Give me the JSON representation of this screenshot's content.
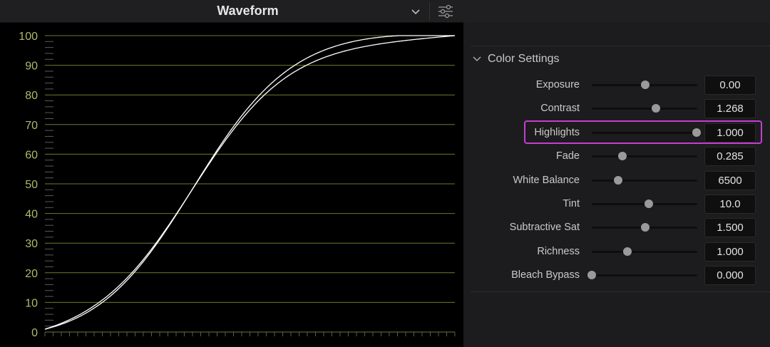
{
  "waveform": {
    "title": "Waveform",
    "y_ticks": [
      "100",
      "90",
      "80",
      "70",
      "60",
      "50",
      "40",
      "30",
      "20",
      "10",
      "0"
    ],
    "colors": {
      "grid": "#6f7a2a",
      "tick_label": "#b3b868",
      "curve": "#ffffff",
      "background": "#000000"
    }
  },
  "color_settings": {
    "title": "Color Settings",
    "params": [
      {
        "label": "Exposure",
        "value": "0.00",
        "level": 0.51
      },
      {
        "label": "Contrast",
        "value": "1.268",
        "level": 0.61
      },
      {
        "label": "Highlights",
        "value": "1.000",
        "level": 0.99,
        "highlighted": true
      },
      {
        "label": "Fade",
        "value": "0.285",
        "level": 0.29
      },
      {
        "label": "White Balance",
        "value": "6500",
        "level": 0.25
      },
      {
        "label": "Tint",
        "value": "10.0",
        "level": 0.54
      },
      {
        "label": "Subtractive Sat",
        "value": "1.500",
        "level": 0.51
      },
      {
        "label": "Richness",
        "value": "1.000",
        "level": 0.34
      },
      {
        "label": "Bleach Bypass",
        "value": "0.000",
        "level": 0.0
      }
    ],
    "highlight_color": "#c43ed3"
  }
}
